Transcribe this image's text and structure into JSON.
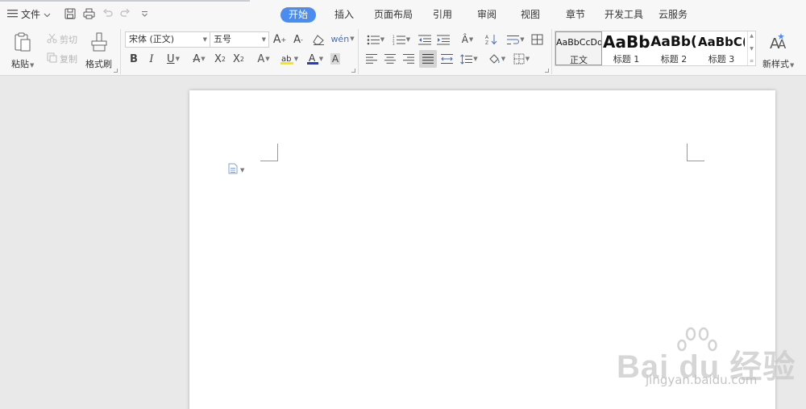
{
  "menu": {
    "file_label": "文件"
  },
  "tabs": [
    {
      "label": "开始",
      "active": true
    },
    {
      "label": "插入",
      "active": false
    },
    {
      "label": "页面布局",
      "active": false
    },
    {
      "label": "引用",
      "active": false
    },
    {
      "label": "审阅",
      "active": false
    },
    {
      "label": "视图",
      "active": false
    },
    {
      "label": "章节",
      "active": false
    },
    {
      "label": "开发工具",
      "active": false
    },
    {
      "label": "云服务",
      "active": false
    }
  ],
  "clipboard": {
    "paste_label": "粘贴",
    "cut_label": "剪切",
    "copy_label": "复制",
    "format_painter_label": "格式刷"
  },
  "font": {
    "family_value": "宋体 (正文)",
    "size_value": "五号"
  },
  "styles": {
    "items": [
      {
        "sample": "AaBbCcDd",
        "name": "正文",
        "selected": true
      },
      {
        "sample": "AaBb",
        "name": "标题 1",
        "selected": false
      },
      {
        "sample": "AaBb(",
        "name": "标题 2",
        "selected": false
      },
      {
        "sample": "AaBbC(",
        "name": "标题 3",
        "selected": false
      }
    ],
    "new_style_label": "新样式"
  },
  "watermark": {
    "brand": "Bai du 经验",
    "url": "jingyan.baidu.com"
  },
  "colors": {
    "accent": "#4a8cf0",
    "highlight": "#ffe600",
    "font_color": "#1f3bd6",
    "strike_red": "#d33"
  }
}
